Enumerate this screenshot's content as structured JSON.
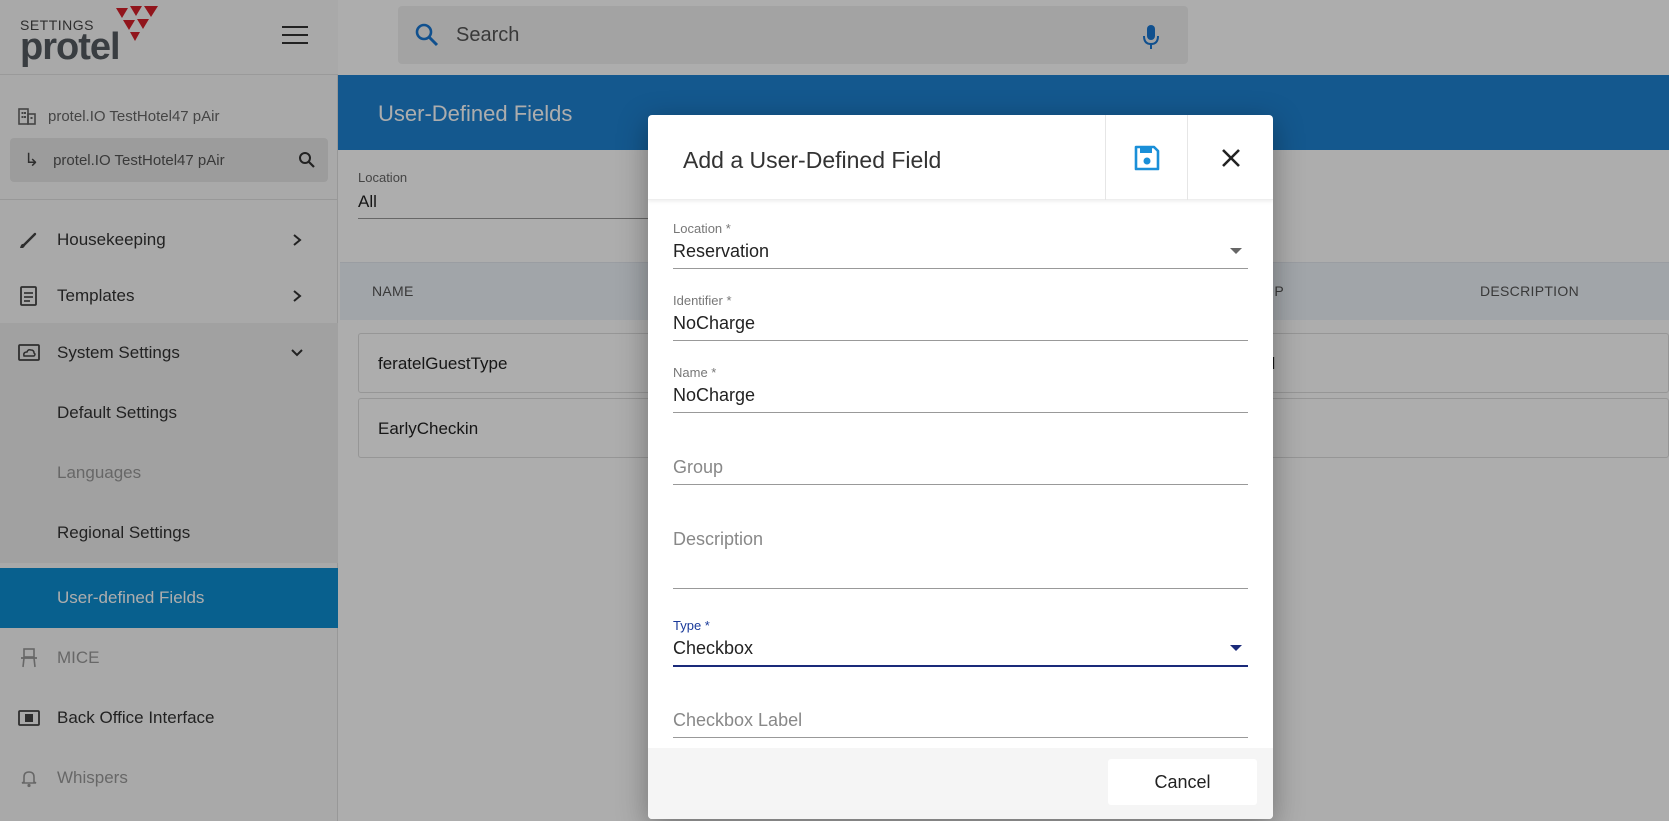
{
  "brand": {
    "settings_label": "SETTINGS",
    "name": "protel",
    "logo_color": "#d6202a"
  },
  "sidebar": {
    "property_name": "protel.IO TestHotel47 pAir",
    "property_selector": "protel.IO TestHotel47 pAir",
    "items": [
      {
        "label": "Housekeeping",
        "icon": "brush-icon",
        "expandable": true
      },
      {
        "label": "Templates",
        "icon": "document-icon",
        "expandable": true
      },
      {
        "label": "System Settings",
        "icon": "cloud-screen-icon",
        "expanded": true
      },
      {
        "label": "Default Settings"
      },
      {
        "label": "Languages",
        "disabled": true
      },
      {
        "label": "Regional Settings"
      },
      {
        "label": "User-defined Fields",
        "active": true
      },
      {
        "label": "MICE",
        "icon": "chair-icon",
        "disabled": true
      },
      {
        "label": "Back Office Interface",
        "icon": "money-icon"
      },
      {
        "label": "Whispers",
        "icon": "bell-icon",
        "disabled": true
      }
    ],
    "active_color": "#0c8ed1"
  },
  "search": {
    "placeholder": "Search"
  },
  "main": {
    "title": "User-Defined Fields",
    "header_color": "#1e82d2",
    "filter": {
      "label": "Location",
      "value": "All"
    },
    "table": {
      "columns": [
        "NAME",
        "UP",
        "DESCRIPTION"
      ],
      "rows": [
        {
          "name": "feratelGuestType",
          "group": "el"
        },
        {
          "name": "EarlyCheckin",
          "group": ""
        }
      ]
    }
  },
  "dialog": {
    "title": "Add a User-Defined Field",
    "accent_color": "#1a8fd8",
    "fields": {
      "location": {
        "label": "Location *",
        "value": "Reservation"
      },
      "identifier": {
        "label": "Identifier *",
        "value": "NoCharge"
      },
      "name": {
        "label": "Name *",
        "value": "NoCharge"
      },
      "group": {
        "placeholder": "Group"
      },
      "description": {
        "placeholder": "Description"
      },
      "type": {
        "label": "Type *",
        "value": "Checkbox"
      },
      "checkbox_label": {
        "placeholder": "Checkbox Label"
      }
    },
    "cancel_label": "Cancel"
  }
}
